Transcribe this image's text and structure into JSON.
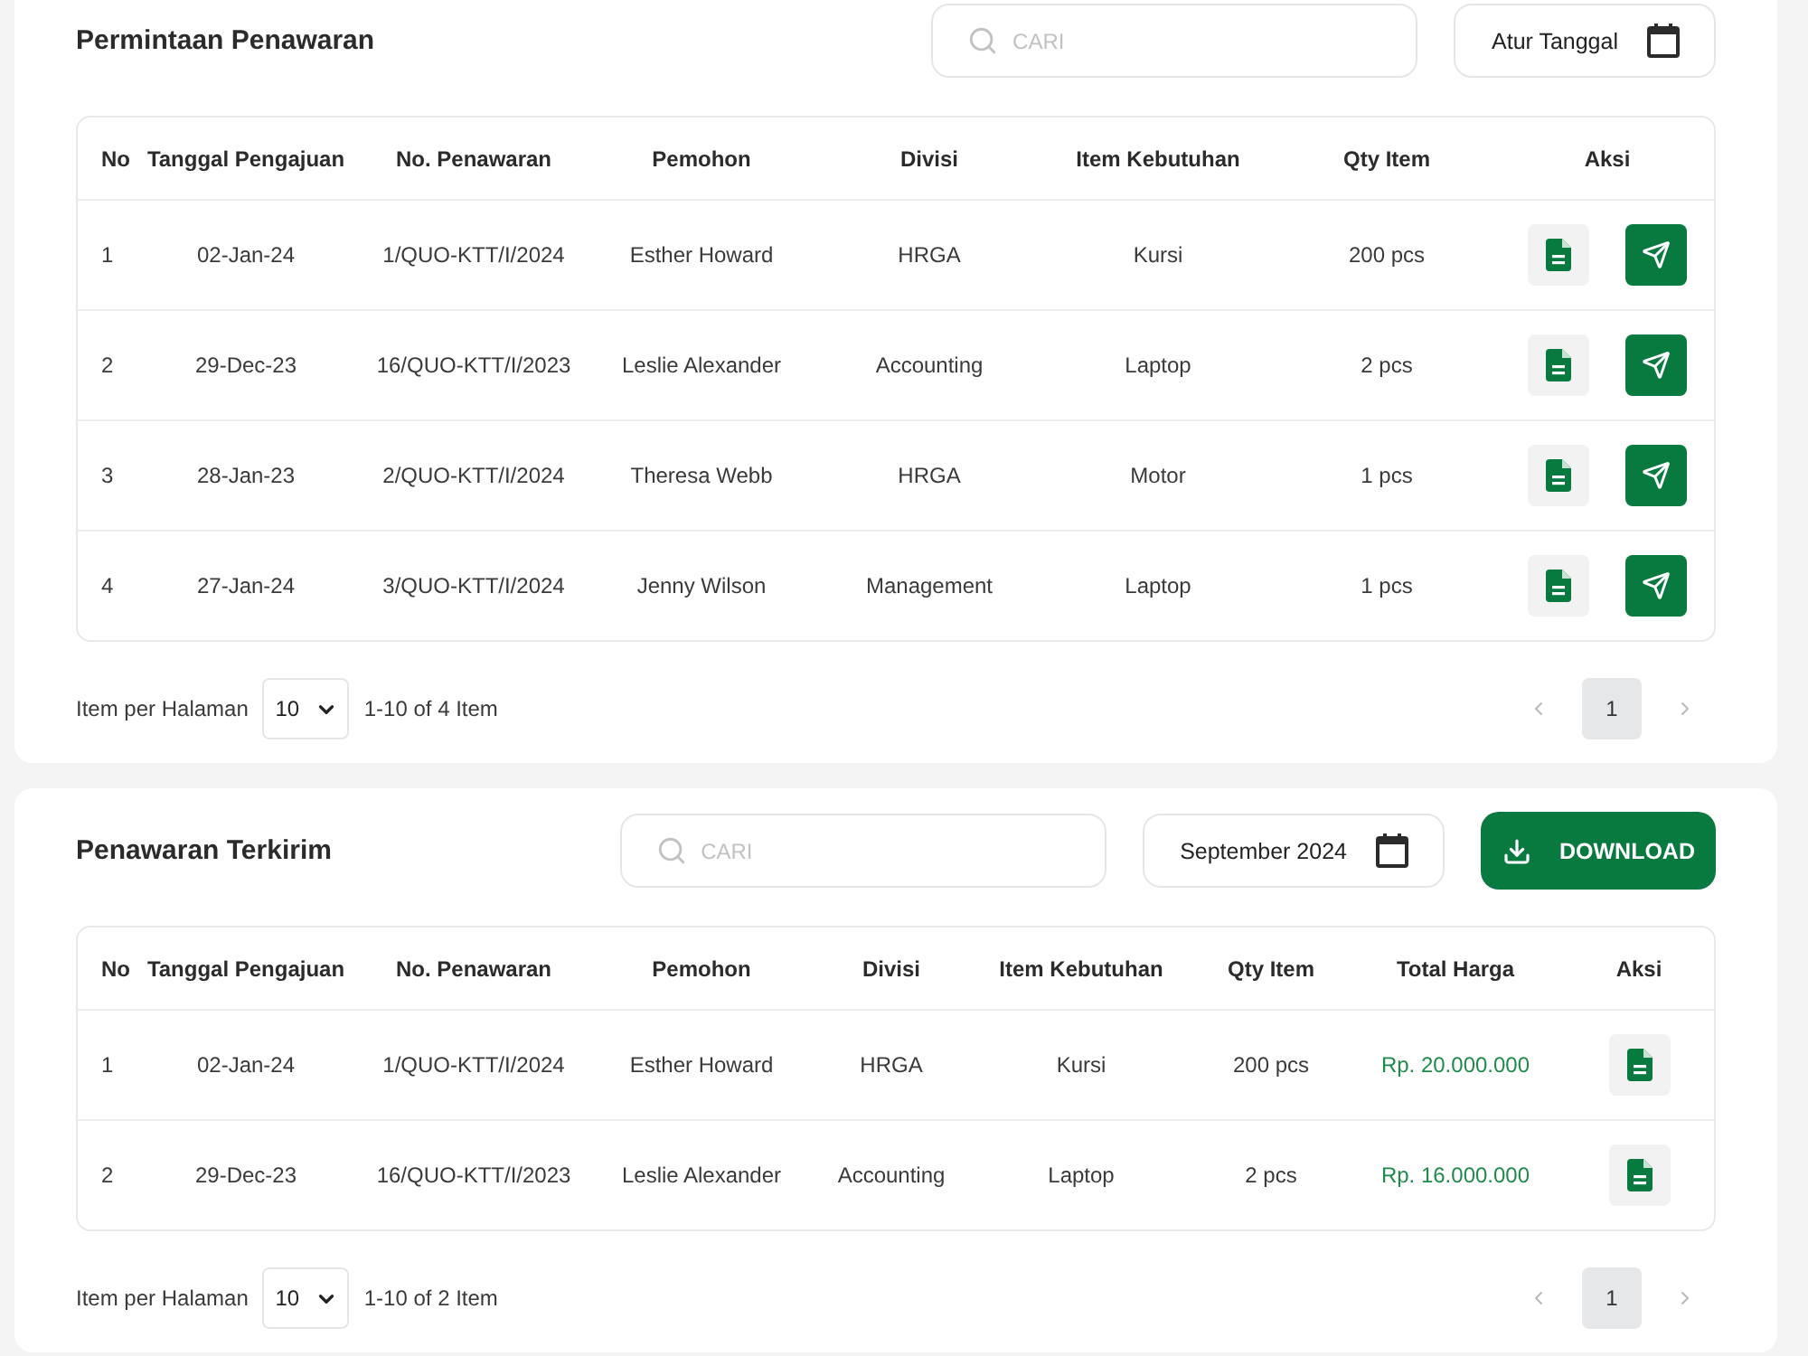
{
  "sections": [
    {
      "title": "Permintaan Penawaran",
      "search": {
        "placeholder": "CARI"
      },
      "date_button": {
        "label": "Atur Tanggal"
      },
      "table": {
        "columns": [
          {
            "label": "No",
            "kind": "index"
          },
          {
            "label": "Tanggal Pengajuan",
            "kind": "text"
          },
          {
            "label": "No. Penawaran",
            "kind": "text"
          },
          {
            "label": "Pemohon",
            "kind": "text"
          },
          {
            "label": "Divisi",
            "kind": "text"
          },
          {
            "label": "Item Kebutuhan",
            "kind": "text"
          },
          {
            "label": "Qty Item",
            "kind": "text"
          },
          {
            "label": "Aksi",
            "kind": "actions"
          }
        ],
        "rows": [
          {
            "cells": [
              "1",
              "02-Jan-24",
              "1/QUO-KTT/I/2024",
              "Esther Howard",
              "HRGA",
              "Kursi",
              "200 pcs"
            ],
            "actions": [
              {
                "kind": "document"
              },
              {
                "kind": "send"
              }
            ]
          },
          {
            "cells": [
              "2",
              "29-Dec-23",
              "16/QUO-KTT/I/2023",
              "Leslie Alexander",
              "Accounting",
              "Laptop",
              "2 pcs"
            ],
            "actions": [
              {
                "kind": "document"
              },
              {
                "kind": "send"
              }
            ]
          },
          {
            "cells": [
              "3",
              "28-Jan-23",
              "2/QUO-KTT/I/2024",
              "Theresa Webb",
              "HRGA",
              "Motor",
              "1 pcs"
            ],
            "actions": [
              {
                "kind": "document"
              },
              {
                "kind": "send"
              }
            ]
          },
          {
            "cells": [
              "4",
              "27-Jan-24",
              "3/QUO-KTT/I/2024",
              "Jenny Wilson",
              "Management",
              "Laptop",
              "1 pcs"
            ],
            "actions": [
              {
                "kind": "document"
              },
              {
                "kind": "send"
              }
            ]
          }
        ]
      },
      "footer": {
        "per_page_label": "Item per Halaman",
        "per_page": "10",
        "range": "1-10 of 4 Item",
        "pages": [
          {
            "label": "1",
            "selected": true
          }
        ]
      }
    },
    {
      "title": "Penawaran Terkirim",
      "search": {
        "placeholder": "CARI"
      },
      "date_button": {
        "label": "September 2024"
      },
      "download_button": {
        "label": "DOWNLOAD"
      },
      "table": {
        "columns": [
          {
            "label": "No",
            "kind": "index"
          },
          {
            "label": "Tanggal Pengajuan",
            "kind": "text"
          },
          {
            "label": "No. Penawaran",
            "kind": "text"
          },
          {
            "label": "Pemohon",
            "kind": "text"
          },
          {
            "label": "Divisi",
            "kind": "text"
          },
          {
            "label": "Item Kebutuhan",
            "kind": "text"
          },
          {
            "label": "Qty Item",
            "kind": "text"
          },
          {
            "label": "Total Harga",
            "kind": "price"
          },
          {
            "label": "Aksi",
            "kind": "actions"
          }
        ],
        "rows": [
          {
            "cells": [
              "1",
              "02-Jan-24",
              "1/QUO-KTT/I/2024",
              "Esther Howard",
              "HRGA",
              "Kursi",
              "200 pcs",
              "Rp. 20.000.000"
            ],
            "actions": [
              {
                "kind": "document"
              }
            ]
          },
          {
            "cells": [
              "2",
              "29-Dec-23",
              "16/QUO-KTT/I/2023",
              "Leslie Alexander",
              "Accounting",
              "Laptop",
              "2 pcs",
              "Rp. 16.000.000"
            ],
            "actions": [
              {
                "kind": "document"
              }
            ]
          }
        ]
      },
      "footer": {
        "per_page_label": "Item per Halaman",
        "per_page": "10",
        "range": "1-10 of 2 Item",
        "pages": [
          {
            "label": "1",
            "selected": true
          }
        ]
      }
    }
  ]
}
